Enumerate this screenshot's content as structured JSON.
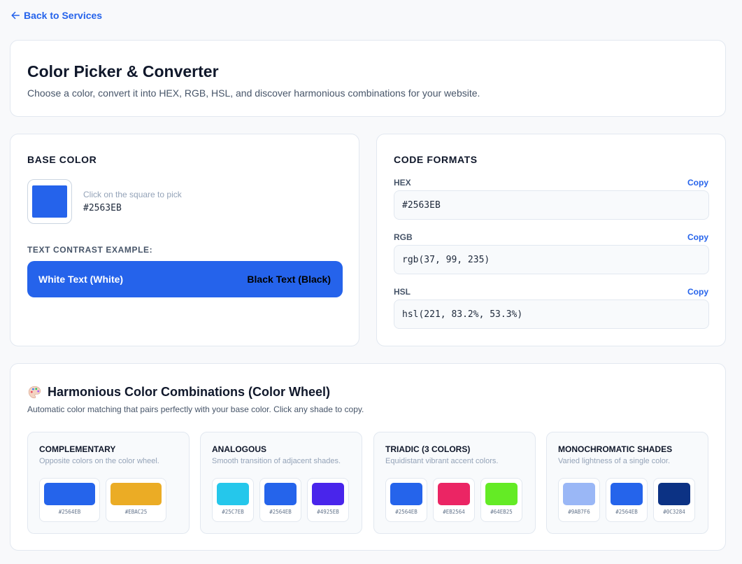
{
  "nav": {
    "back_label": "Back to Services"
  },
  "header": {
    "title": "Color Picker & Converter",
    "subtitle": "Choose a color, convert it into HEX, RGB, HSL, and discover harmonious combinations for your website."
  },
  "base": {
    "title": "BASE COLOR",
    "color": "#2563EB",
    "hint": "Click on the square to pick",
    "hex": "#2563EB",
    "contrast_label": "TEXT CONTRAST EXAMPLE:",
    "white_text": "White Text (White)",
    "black_text": "Black Text (Black)"
  },
  "formats": {
    "title": "CODE FORMATS",
    "copy_label": "Copy",
    "items": [
      {
        "label": "HEX",
        "value": "#2563EB"
      },
      {
        "label": "RGB",
        "value": "rgb(37, 99, 235)"
      },
      {
        "label": "HSL",
        "value": "hsl(221, 83.2%, 53.3%)"
      }
    ]
  },
  "harmony": {
    "icon": "palette-icon",
    "title": "Harmonious Color Combinations (Color Wheel)",
    "subtitle": "Automatic color matching that pairs perfectly with your base color. Click any shade to copy.",
    "groups": [
      {
        "title": "COMPLEMENTARY",
        "desc": "Opposite colors on the color wheel.",
        "colors": [
          {
            "hex": "#2564EB"
          },
          {
            "hex": "#EBAC25"
          }
        ]
      },
      {
        "title": "ANALOGOUS",
        "desc": "Smooth transition of adjacent shades.",
        "colors": [
          {
            "hex": "#25C7EB"
          },
          {
            "hex": "#2564EB"
          },
          {
            "hex": "#4925EB"
          }
        ]
      },
      {
        "title": "TRIADIC (3 COLORS)",
        "desc": "Equidistant vibrant accent colors.",
        "colors": [
          {
            "hex": "#2564EB"
          },
          {
            "hex": "#EB2564"
          },
          {
            "hex": "#64EB25"
          }
        ]
      },
      {
        "title": "MONOCHROMATIC SHADES",
        "desc": "Varied lightness of a single color.",
        "colors": [
          {
            "hex": "#9AB7F6"
          },
          {
            "hex": "#2564EB"
          },
          {
            "hex": "#0C3284"
          }
        ]
      }
    ]
  }
}
